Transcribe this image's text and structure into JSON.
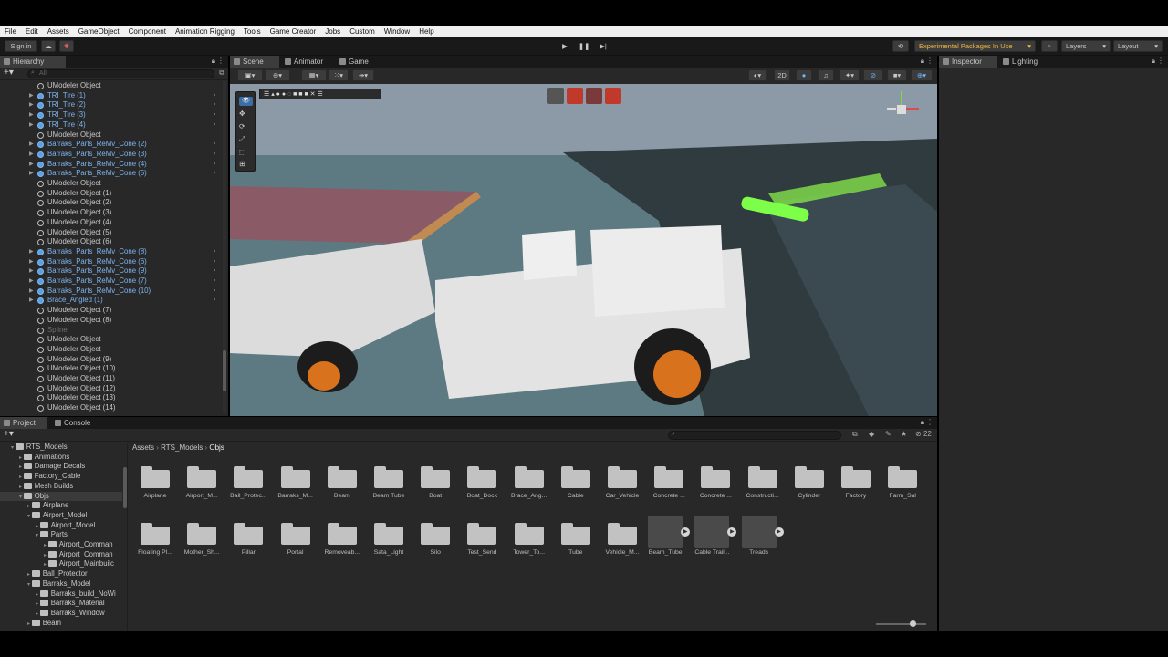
{
  "menu": [
    "File",
    "Edit",
    "Assets",
    "GameObject",
    "Component",
    "Animation Rigging",
    "Tools",
    "Game Creator",
    "Jobs",
    "Custom",
    "Window",
    "Help"
  ],
  "toolbar": {
    "sign_in": "Sign in",
    "experimental": "Experimental Packages In Use",
    "layers": "Layers",
    "layout": "Layout"
  },
  "hierarchy": {
    "title": "Hierarchy",
    "search_placeholder": "All",
    "rows": [
      {
        "label": "UModeler Object",
        "type": "obj"
      },
      {
        "label": "TRI_Tire (1)",
        "type": "prefab"
      },
      {
        "label": "TRI_Tire (2)",
        "type": "prefab"
      },
      {
        "label": "TRI_Tire (3)",
        "type": "prefab"
      },
      {
        "label": "TRI_Tire (4)",
        "type": "prefab"
      },
      {
        "label": "UModeler Object",
        "type": "obj"
      },
      {
        "label": "Barraks_Parts_ReMv_Cone (2)",
        "type": "prefab"
      },
      {
        "label": "Barraks_Parts_ReMv_Cone (3)",
        "type": "prefab"
      },
      {
        "label": "Barraks_Parts_ReMv_Cone (4)",
        "type": "prefab"
      },
      {
        "label": "Barraks_Parts_ReMv_Cone (5)",
        "type": "prefab"
      },
      {
        "label": "UModeler Object",
        "type": "obj"
      },
      {
        "label": "UModeler Object (1)",
        "type": "obj"
      },
      {
        "label": "UModeler Object (2)",
        "type": "obj"
      },
      {
        "label": "UModeler Object (3)",
        "type": "obj"
      },
      {
        "label": "UModeler Object (4)",
        "type": "obj"
      },
      {
        "label": "UModeler Object (5)",
        "type": "obj"
      },
      {
        "label": "UModeler Object (6)",
        "type": "obj"
      },
      {
        "label": "Barraks_Parts_ReMv_Cone (8)",
        "type": "prefab"
      },
      {
        "label": "Barraks_Parts_ReMv_Cone (6)",
        "type": "prefab"
      },
      {
        "label": "Barraks_Parts_ReMv_Cone (9)",
        "type": "prefab"
      },
      {
        "label": "Barraks_Parts_ReMv_Cone (7)",
        "type": "prefab"
      },
      {
        "label": "Barraks_Parts_ReMv_Cone (10)",
        "type": "prefab"
      },
      {
        "label": "Brace_Angled (1)",
        "type": "prefab"
      },
      {
        "label": "UModeler Object (7)",
        "type": "obj"
      },
      {
        "label": "UModeler Object (8)",
        "type": "obj"
      },
      {
        "label": "Spline",
        "type": "dim"
      },
      {
        "label": "UModeler Object",
        "type": "obj"
      },
      {
        "label": "UModeler Object",
        "type": "obj"
      },
      {
        "label": "UModeler Object (9)",
        "type": "obj"
      },
      {
        "label": "UModeler Object (10)",
        "type": "obj"
      },
      {
        "label": "UModeler Object (11)",
        "type": "obj"
      },
      {
        "label": "UModeler Object (12)",
        "type": "obj"
      },
      {
        "label": "UModeler Object (13)",
        "type": "obj"
      },
      {
        "label": "UModeler Object (14)",
        "type": "obj"
      }
    ]
  },
  "scene": {
    "tabs": [
      "Scene",
      "Animator",
      "Game"
    ],
    "mode_2d": "2D"
  },
  "inspector": {
    "tabs": [
      "Inspector",
      "Lighting"
    ]
  },
  "project": {
    "tabs": [
      "Project",
      "Console"
    ],
    "breadcrumb": [
      "Assets",
      "RTS_Models",
      "Objs"
    ],
    "count": "22",
    "tree": [
      {
        "label": "RTS_Models",
        "indent": 0,
        "open": true
      },
      {
        "label": "Animations",
        "indent": 1
      },
      {
        "label": "Damage Decals",
        "indent": 1
      },
      {
        "label": "Factory_Cable",
        "indent": 1
      },
      {
        "label": "Mesh Builds",
        "indent": 1
      },
      {
        "label": "Objs",
        "indent": 1,
        "open": true,
        "selected": true
      },
      {
        "label": "Airplane",
        "indent": 2
      },
      {
        "label": "Airport_Model",
        "indent": 2,
        "open": true
      },
      {
        "label": "Airport_Model",
        "indent": 3
      },
      {
        "label": "Parts",
        "indent": 3,
        "open": true
      },
      {
        "label": "Airport_Comman",
        "indent": 4
      },
      {
        "label": "Airport_Comman",
        "indent": 4
      },
      {
        "label": "Airport_Mainbuilc",
        "indent": 4
      },
      {
        "label": "Ball_Protector",
        "indent": 2
      },
      {
        "label": "Barraks_Model",
        "indent": 2,
        "open": true
      },
      {
        "label": "Barraks_build_NoWi",
        "indent": 3
      },
      {
        "label": "Barraks_Material",
        "indent": 3
      },
      {
        "label": "Barraks_Window",
        "indent": 3
      },
      {
        "label": "Beam",
        "indent": 2
      }
    ],
    "row1": [
      "Airplane",
      "Airport_M...",
      "Ball_Protec...",
      "Barraks_M...",
      "Beam",
      "Beam Tube",
      "Boat",
      "Boat_Dock",
      "Brace_Ang...",
      "Cable",
      "Car_Vehicle",
      "Concrete ...",
      "Concrete ...",
      "Constructi...",
      "Cylinder",
      "Factory",
      "Farm_Sal"
    ],
    "row2": [
      "Floating Pl...",
      "Mother_Sh...",
      "Pillar",
      "Portal",
      "Removeab...",
      "Sata_Light",
      "Silo",
      "Test_Send",
      "Tower_To...",
      "Tube",
      "Vehicle_M..."
    ],
    "assets": [
      "Beam_Tube",
      "Cable Trail...",
      "Treads"
    ]
  }
}
